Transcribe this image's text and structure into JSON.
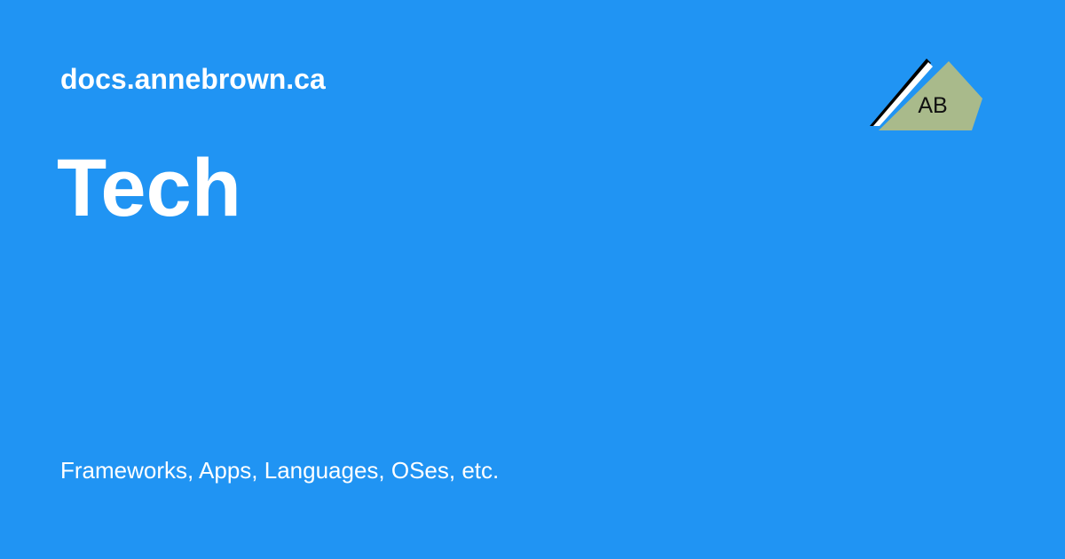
{
  "site": {
    "name": "docs.annebrown.ca"
  },
  "page": {
    "title": "Tech",
    "description": "Frameworks, Apps, Languages, OSes, etc."
  },
  "logo": {
    "text": "AB",
    "icon": "ab-triangle-logo"
  },
  "colors": {
    "background": "#2094f3",
    "text": "#ffffff",
    "logo_fill": "#a9ba8b",
    "logo_stroke": "#000000"
  }
}
